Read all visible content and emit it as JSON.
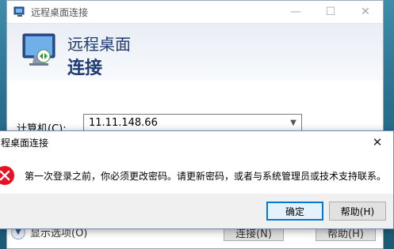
{
  "background_window": {
    "title": "远程桌面连接",
    "header_line1": "远程桌面",
    "header_line2": "连接",
    "computer_label": "计算机(C):",
    "computer_value": "11.11.148.66",
    "options_label": "显示选项(O)",
    "connect_button": "连接(N)",
    "help_button": "帮助(H)"
  },
  "error_dialog": {
    "title": "程桌面连接",
    "message": "第一次登录之前，你必须更改密码。请更新密码，或者与系统管理员或技术支持联系。",
    "ok_button": "确定",
    "help_button": "帮助(H)"
  },
  "colors": {
    "accent": "#0078d7",
    "error_red": "#e81123",
    "title_blue": "#1e3b72"
  }
}
